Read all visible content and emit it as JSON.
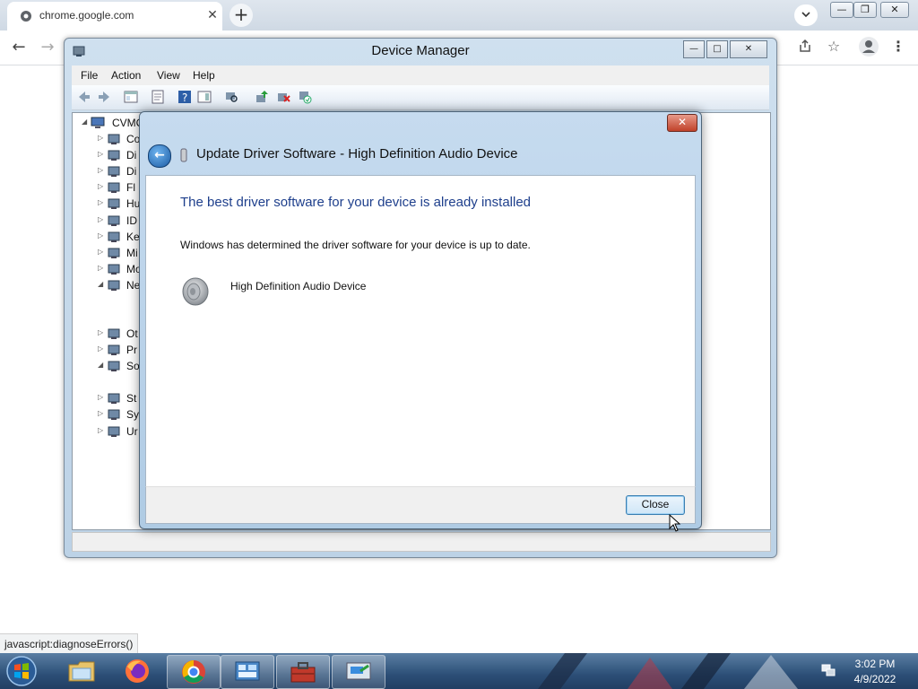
{
  "browser": {
    "tab_title": "chrome.google.com",
    "tab_close": "✕",
    "new_tab": "+",
    "status_bubble": "javascript:diagnoseErrors()"
  },
  "device_manager": {
    "title": "Device Manager",
    "menu": [
      "File",
      "Action",
      "View",
      "Help"
    ],
    "tree": {
      "root": "CVMC",
      "items": [
        {
          "label": "Co",
          "icon": "computer-icon"
        },
        {
          "label": "Di",
          "icon": "disk-drive-icon"
        },
        {
          "label": "Di",
          "icon": "display-adapter-icon"
        },
        {
          "label": "Fl",
          "icon": "floppy-icon"
        },
        {
          "label": "Hu",
          "icon": "hid-icon"
        },
        {
          "label": "ID",
          "icon": "ide-icon"
        },
        {
          "label": "Ke",
          "icon": "keyboard-icon"
        },
        {
          "label": "Mi",
          "icon": "mouse-icon"
        },
        {
          "label": "Mo",
          "icon": "monitor-icon"
        },
        {
          "label": "Ne",
          "icon": "network-icon"
        },
        {
          "label": "Ot",
          "icon": "other-devices-icon"
        },
        {
          "label": "Pr",
          "icon": "processor-icon"
        },
        {
          "label": "So",
          "icon": "sound-icon"
        },
        {
          "label": "St",
          "icon": "storage-icon"
        },
        {
          "label": "Sy",
          "icon": "system-icon"
        },
        {
          "label": "Ur",
          "icon": "usb-icon"
        }
      ]
    }
  },
  "dialog": {
    "title": "Update Driver Software - High Definition Audio Device",
    "close_glyph": "✕",
    "heading": "The best driver software for your device is already installed",
    "message": "Windows has determined the driver software for your device is up to date.",
    "device_name": "High Definition Audio Device",
    "close_button": "Close"
  },
  "taskbar": {
    "apps": [
      "file-explorer",
      "firefox",
      "chrome",
      "control-panel",
      "toolbox",
      "device-manager"
    ],
    "time": "3:02 PM",
    "date": "4/9/2022"
  },
  "colors": {
    "dialog_heading": "#1e3f8c",
    "taskbar": "#2c4f77",
    "close_accent": "#c0422a"
  }
}
